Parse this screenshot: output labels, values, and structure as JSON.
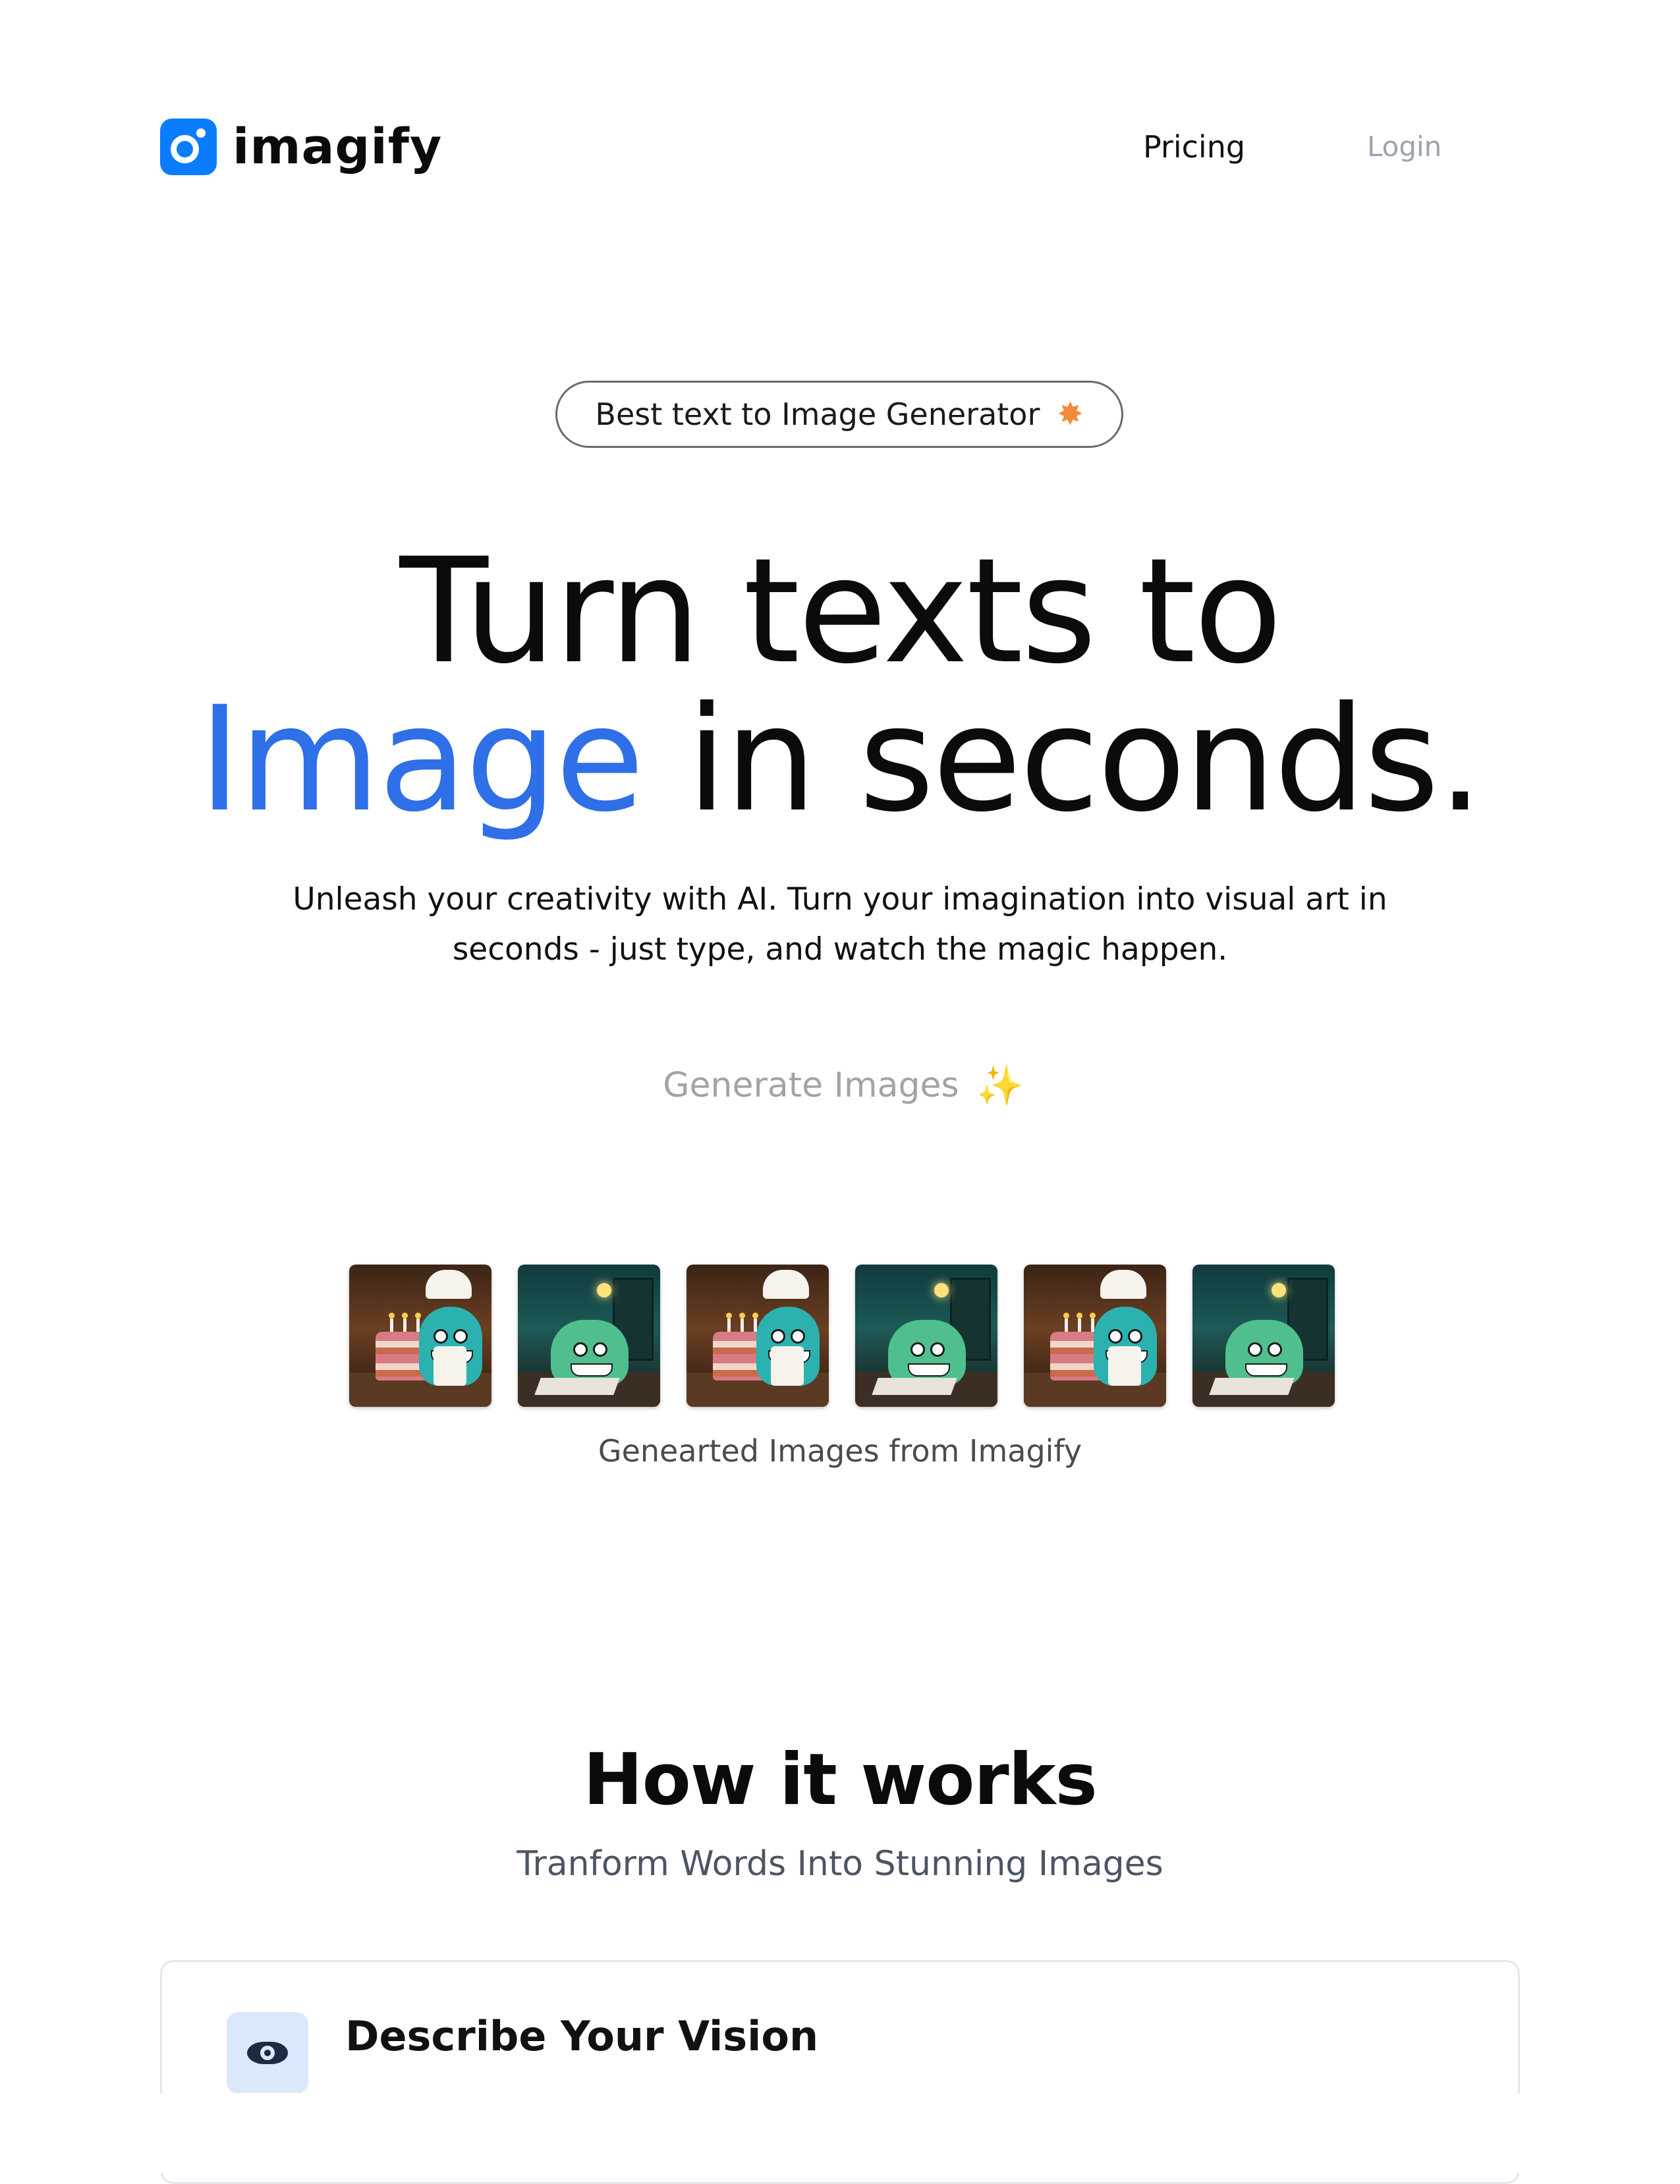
{
  "header": {
    "brand": "imagify",
    "nav": {
      "pricing": "Pricing",
      "login": "Login"
    }
  },
  "hero": {
    "badge": {
      "label": "Best text to Image Generator",
      "icon": "star-icon"
    },
    "title_line1": "Turn texts to",
    "title_accent": "Image",
    "title_rest": " in seconds.",
    "subtitle": "Unleash your creativity with AI. Turn your imagination into visual art in seconds - just type, and watch the magic happen.",
    "cta": {
      "label": "Generate Images",
      "icon": "sparkle-icon"
    }
  },
  "gallery": {
    "images": [
      "chef-monster-cake",
      "monster-with-lamp",
      "chef-monster-cake",
      "monster-with-lamp",
      "chef-monster-cake",
      "monster-with-lamp"
    ],
    "caption": "Genearted Images from Imagify"
  },
  "how_it_works": {
    "title": "How it works",
    "subtitle": "Tranform Words Into Stunning Images",
    "steps": [
      {
        "icon": "eye-icon",
        "title": "Describe Your Vision"
      }
    ]
  },
  "colors": {
    "brand_blue": "#0a7dff",
    "accent_blue": "#2f6fe8",
    "muted_text": "#9ca3af"
  }
}
